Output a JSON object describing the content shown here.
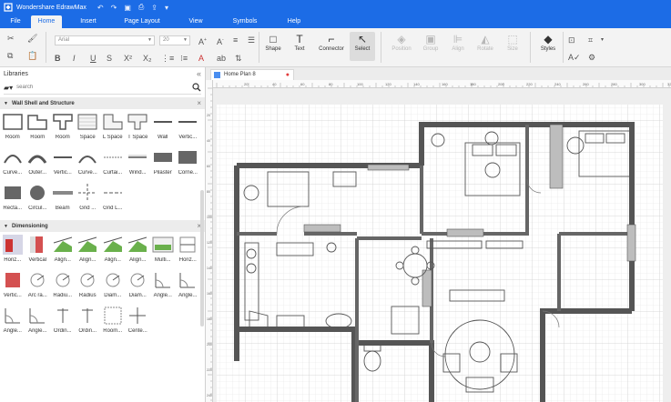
{
  "app": {
    "title": "Wondershare EdrawMax"
  },
  "quick_access": [
    "undo-icon",
    "redo-icon",
    "save-icon",
    "print-icon",
    "export-icon",
    "more-icon"
  ],
  "menu": [
    "File",
    "Home",
    "Insert",
    "Page Layout",
    "View",
    "Symbols",
    "Help"
  ],
  "ribbon": {
    "font_family": "Arial",
    "font_size": "20",
    "tools": {
      "shape": "Shape",
      "text": "Text",
      "connector": "Connector",
      "select": "Select"
    },
    "arrange": {
      "position": "Position",
      "group": "Group",
      "align": "Align",
      "rotate": "Rotate",
      "size": "Size"
    },
    "styles": "Styles"
  },
  "libraries": {
    "title": "Libraries",
    "search_placeholder": "search",
    "wall_section": {
      "title": "Wall Shell and Structure",
      "items": [
        "Room",
        "Room",
        "Room",
        "Space",
        "L Space",
        "T Space",
        "Wall",
        "Vertic...",
        "Curve...",
        "Outer...",
        "Vertic...",
        "Curve...",
        "Curtai...",
        "Wind...",
        "Pilaster",
        "Corne...",
        "Recta...",
        "Circul...",
        "Beam",
        "Grid ...",
        "Grid L..."
      ]
    },
    "dim_section": {
      "title": "Dimensioning",
      "items": [
        "Horiz...",
        "Vertical",
        "Align...",
        "Align...",
        "Align...",
        "Align...",
        "Multi...",
        "Horiz...",
        "Vertic...",
        "Arc ra...",
        "Radiu...",
        "Radius",
        "Diam...",
        "Diam...",
        "Angle...",
        "Angle...",
        "Angle...",
        "Angle...",
        "Ordin...",
        "Ordin...",
        "Room...",
        "Cente..."
      ]
    }
  },
  "document": {
    "tab_title": "Home Plan 8"
  },
  "ruler": {
    "h_labels": [
      "20",
      "40",
      "60",
      "80",
      "100",
      "120",
      "140",
      "160",
      "180",
      "200",
      "220",
      "240",
      "260",
      "280",
      "300",
      "320"
    ],
    "v_labels": [
      "20",
      "40",
      "60",
      "80",
      "100",
      "120",
      "140",
      "160",
      "180",
      "200",
      "220",
      "240"
    ]
  },
  "colors": {
    "accent": "#1c6ce6",
    "wall": "#555555",
    "canvas_bg": "#eeeeee",
    "tab_close": "#e23b3b"
  }
}
